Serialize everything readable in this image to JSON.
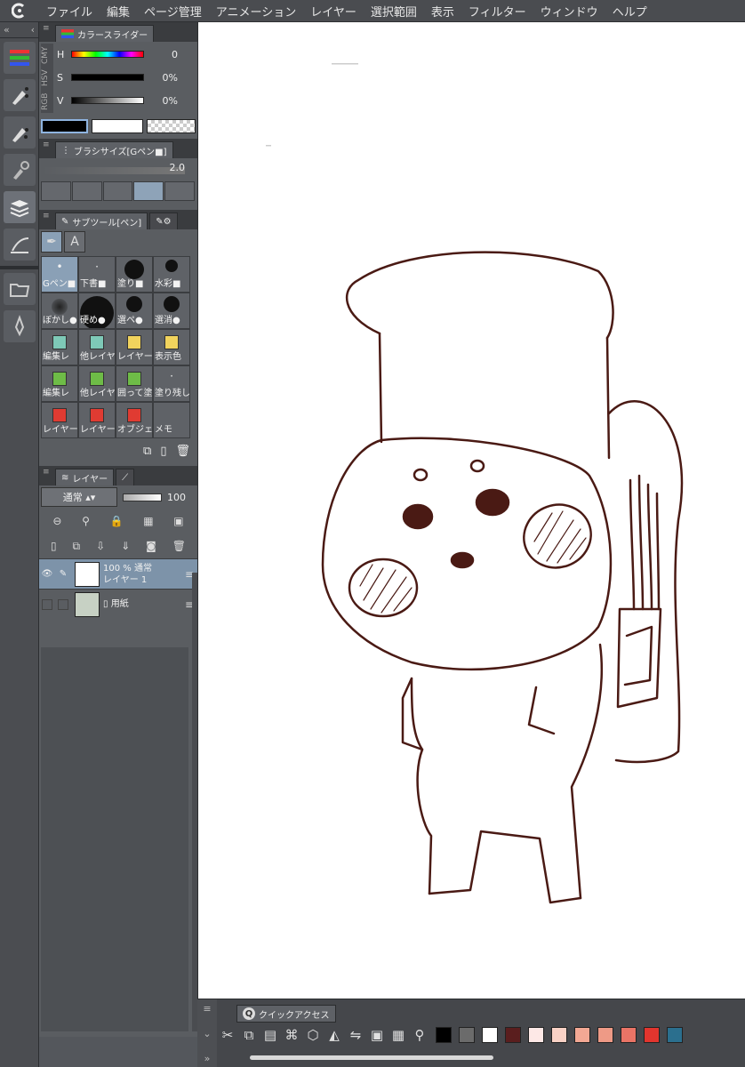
{
  "menubar": {
    "logo_icon": "csp-logo-icon",
    "items": [
      "ファイル",
      "編集",
      "ページ管理",
      "アニメーション",
      "レイヤー",
      "選択範囲",
      "表示",
      "フィルター",
      "ウィンドウ",
      "ヘルプ"
    ]
  },
  "toolstrip": {
    "tools": [
      "color-slider-icon",
      "pen-tool-icon",
      "pen-variant-icon",
      "decoration-icon",
      "layer-stack-icon",
      "ruler-icon",
      "folder-icon",
      "fill-pen-icon"
    ]
  },
  "color_panel": {
    "tab_label": "カラースライダー",
    "modes": [
      "RGB",
      "HSV",
      "CMY"
    ],
    "rows": [
      {
        "label": "H",
        "value": "0"
      },
      {
        "label": "S",
        "value": "0%"
      },
      {
        "label": "V",
        "value": "0%"
      }
    ],
    "main_color": "#000000",
    "sub_color": "#ffffff"
  },
  "brush_panel": {
    "tab_label": "ブラシサイズ[Gペン■]",
    "value": "2.0"
  },
  "subtool_panel": {
    "tab_label": "サブツール[ペン]",
    "text_icon": "A",
    "items": [
      {
        "label": "Gペン■",
        "selected": true
      },
      {
        "label": "下書■"
      },
      {
        "label": "塗り■"
      },
      {
        "label": "水彩■"
      },
      {
        "label": "ぼかし●"
      },
      {
        "label": "硬め●"
      },
      {
        "label": "選ペ●"
      },
      {
        "label": "選消●"
      },
      {
        "label": "編集レ"
      },
      {
        "label": "他レイヤ"
      },
      {
        "label": "レイヤー"
      },
      {
        "label": "表示色"
      },
      {
        "label": "編集レ"
      },
      {
        "label": "他レイヤ"
      },
      {
        "label": "囲って塗"
      },
      {
        "label": "塗り残し"
      },
      {
        "label": "レイヤー"
      },
      {
        "label": "レイヤー"
      },
      {
        "label": "オブジェ"
      },
      {
        "label": "メモ"
      }
    ]
  },
  "layer_panel": {
    "tab_label": "レイヤー",
    "blend_mode": "通常",
    "opacity": "100",
    "layers": [
      {
        "line1": "100 % 通常",
        "line2": "レイヤー 1",
        "selected": true
      },
      {
        "line1": "",
        "line2": "用紙",
        "selected": false
      }
    ]
  },
  "quick_access": {
    "tab_label": "クイックアクセス",
    "colors": [
      "#000000",
      "#6b6b6b",
      "#ffffff",
      "#5a1e1e",
      "#fde8e6",
      "#f9d2c6",
      "#f3a894",
      "#ee9a86",
      "#ea7466",
      "#e2352e",
      "#2b6f8e"
    ]
  }
}
